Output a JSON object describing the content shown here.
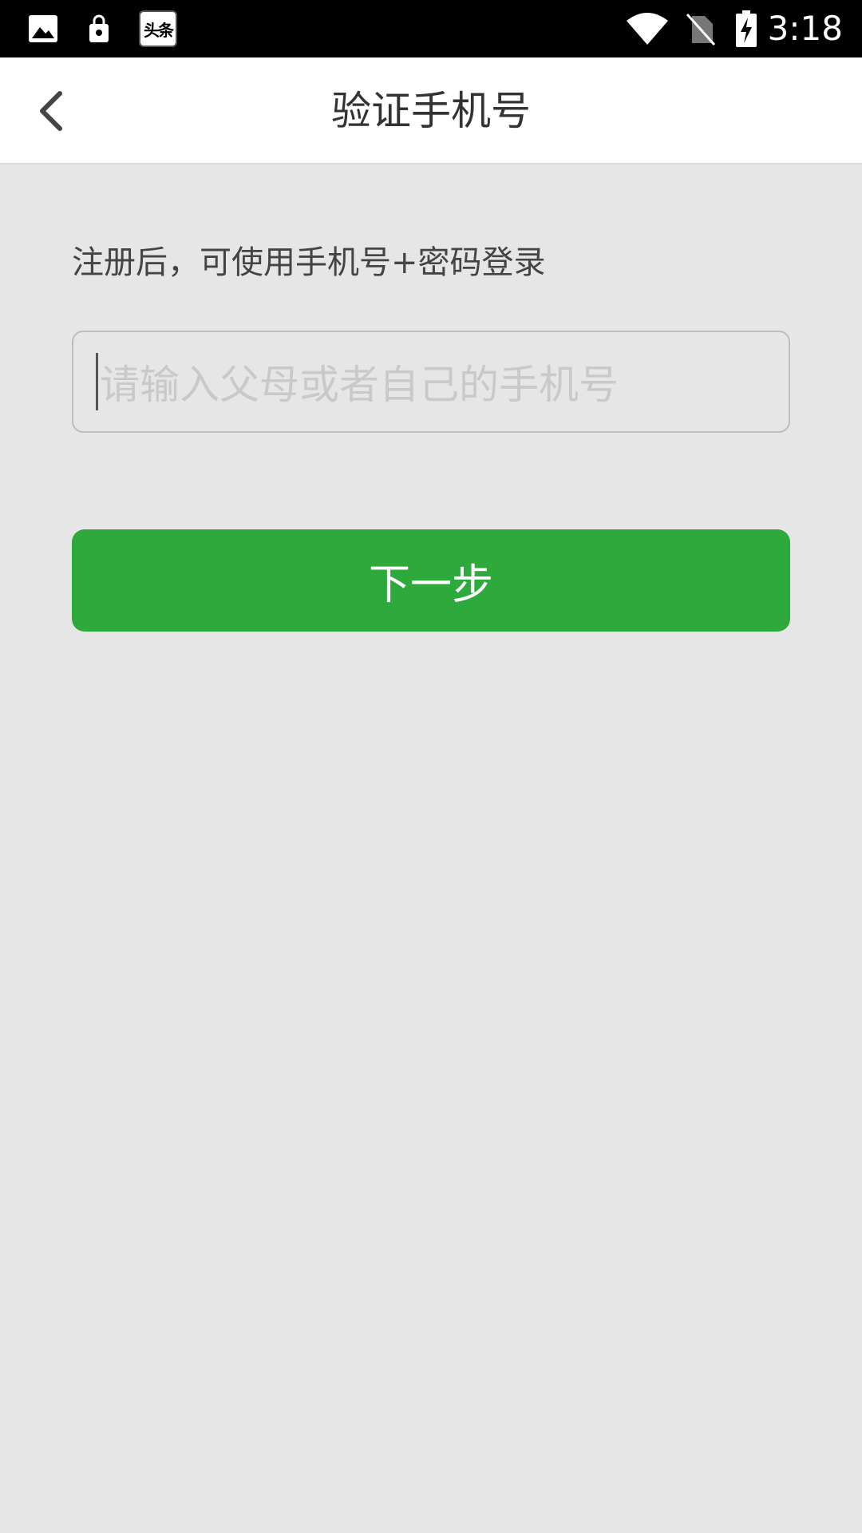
{
  "status_bar": {
    "time": "3:18",
    "news_badge": "头条",
    "icons": [
      "image-icon",
      "lock-bag-icon",
      "toutiao-app-icon",
      "wifi-icon",
      "no-sim-icon",
      "battery-charging-icon"
    ]
  },
  "header": {
    "title": "验证手机号",
    "back_icon": "chevron-left-icon"
  },
  "main": {
    "hint": "注册后，可使用手机号+密码登录",
    "phone_input": {
      "value": "",
      "placeholder": "请输入父母或者自己的手机号"
    },
    "next_button_label": "下一步"
  },
  "colors": {
    "status_bar": "#000000",
    "app_bar": "#ffffff",
    "page_background": "#e6e6e7",
    "primary_button": "#2daa3b",
    "placeholder_text": "#c9c9c9"
  }
}
